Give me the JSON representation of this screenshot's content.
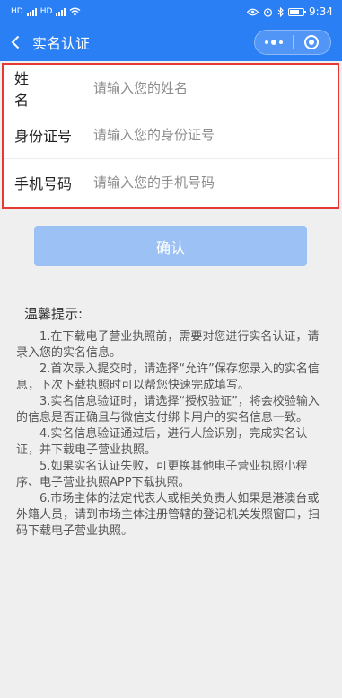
{
  "status_bar": {
    "left_badges": [
      "HD",
      "HD"
    ],
    "time": "9:34"
  },
  "nav": {
    "title": "实名认证"
  },
  "form": {
    "fields": [
      {
        "label": "姓    名",
        "placeholder": "请输入您的姓名"
      },
      {
        "label": "身份证号",
        "placeholder": "请输入您的身份证号"
      },
      {
        "label": "手机号码",
        "placeholder": "请输入您的手机号码"
      }
    ]
  },
  "confirm_label": "确认",
  "tips": {
    "title": "温馨提示:",
    "items": [
      "1.在下载电子营业执照前，需要对您进行实名认证，请录入您的实名信息。",
      "2.首次录入提交时，请选择“允许”保存您录入的实名信息，下次下载执照时可以帮您快速完成填写。",
      "3.实名信息验证时，请选择“授权验证”，将会校验输入的信息是否正确且与微信支付绑卡用户的实名信息一致。",
      "4.实名信息验证通过后，进行人脸识别，完成实名认证，并下载电子营业执照。",
      "5.如果实名认证失败，可更换其他电子营业执照小程序、电子营业执照APP下载执照。",
      "6.市场主体的法定代表人或相关负责人如果是港澳台或外籍人员，请到市场主体注册管辖的登记机关发照窗口，扫码下载电子营业执照。"
    ]
  },
  "colors": {
    "primary": "#2b7ff5",
    "button_disabled": "#9cc1f5",
    "highlight_border": "#e53935"
  }
}
